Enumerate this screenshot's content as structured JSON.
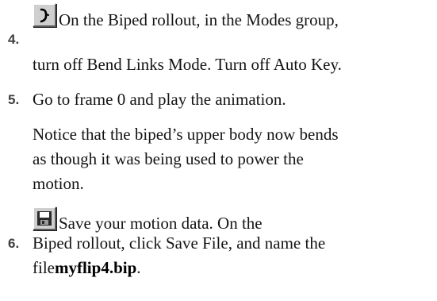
{
  "steps": [
    {
      "number": "4.",
      "icon": "bend-links-mode-icon",
      "line1": "On the Biped rollout, in the Modes group,",
      "line2": "turn off Bend Links Mode. Turn off Auto Key."
    },
    {
      "number": "5.",
      "line1": "Go to frame 0 and play the animation."
    },
    {
      "note": {
        "line1": "Notice that the biped’s upper body now bends",
        "line2": "as though it was being used to power the",
        "line3": "motion."
      }
    },
    {
      "number": "6.",
      "icon": "save-file-icon",
      "line1": "Save your motion data.  On the",
      "line2": "Biped rollout, click Save File, and name the",
      "line3_prefix": "file",
      "filename": "myflip4.bip",
      "line3_suffix": "."
    }
  ]
}
